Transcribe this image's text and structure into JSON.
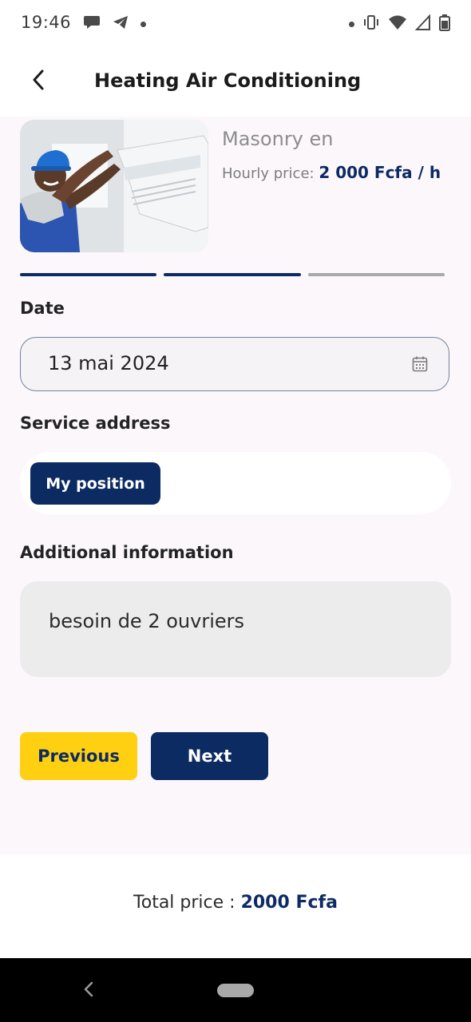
{
  "status_bar": {
    "time": "19:46",
    "left_icons": [
      "chat-bubble-icon",
      "telegram-icon",
      "dot-icon"
    ],
    "right_icons": [
      "dot-icon",
      "vibrate-icon",
      "wifi-icon",
      "signal-icon",
      "battery-icon"
    ]
  },
  "app_bar": {
    "title": "Heating Air Conditioning",
    "back_icon": "chevron-left-icon"
  },
  "service": {
    "name": "Masonry en",
    "hourly_label": "Hourly price: ",
    "hourly_value": "2 000 Fcfa / h"
  },
  "steps": {
    "total": 3,
    "completed": 2,
    "active_color": "#0d2b63",
    "inactive_color": "#a9a9a9"
  },
  "form": {
    "date_label": "Date",
    "date_value": "13 mai 2024",
    "address_label": "Service address",
    "my_position_label": "My position",
    "info_label": "Additional information",
    "info_value": "besoin de 2 ouvriers"
  },
  "buttons": {
    "previous": "Previous",
    "next": "Next"
  },
  "footer": {
    "total_label": "Total price : ",
    "total_value": "2000 Fcfa"
  },
  "colors": {
    "brand_navy": "#0d2b63",
    "brand_yellow": "#ffd012",
    "background": "#fcf7fb"
  }
}
